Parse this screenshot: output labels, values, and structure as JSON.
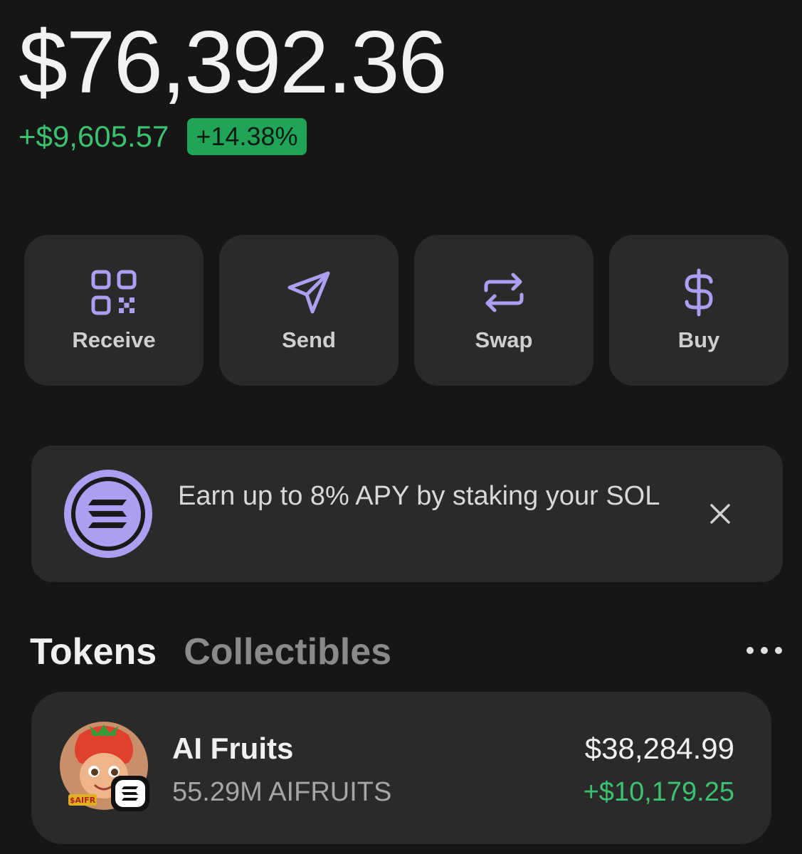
{
  "balance": {
    "total": "$76,392.36",
    "change_amount": "+$9,605.57",
    "change_percent": "+14.38%"
  },
  "actions": [
    {
      "label": "Receive",
      "icon": "qr-code-icon"
    },
    {
      "label": "Send",
      "icon": "send-icon"
    },
    {
      "label": "Swap",
      "icon": "swap-icon"
    },
    {
      "label": "Buy",
      "icon": "dollar-icon"
    }
  ],
  "promo": {
    "text": "Earn up to 8% APY by staking your SOL",
    "logo_icon": "solana-logo-icon",
    "close_icon": "close-icon"
  },
  "tabs": [
    {
      "label": "Tokens",
      "active": true
    },
    {
      "label": "Collectibles",
      "active": false
    }
  ],
  "more_icon": "more-dots-icon",
  "tokens": [
    {
      "name": "AI Fruits",
      "amount": "55.29M AIFRUITS",
      "value": "$38,284.99",
      "change": "+$10,179.25",
      "avatar_text": "$AIFR",
      "avatar_icon": "strawberry-avatar-icon",
      "chain_badge_icon": "solana-badge-icon"
    }
  ],
  "colors": {
    "background": "#161616",
    "card": "#2a2a2a",
    "accent": "#ab9ff2",
    "positive": "#3bc16f",
    "badge": "#20a458"
  }
}
